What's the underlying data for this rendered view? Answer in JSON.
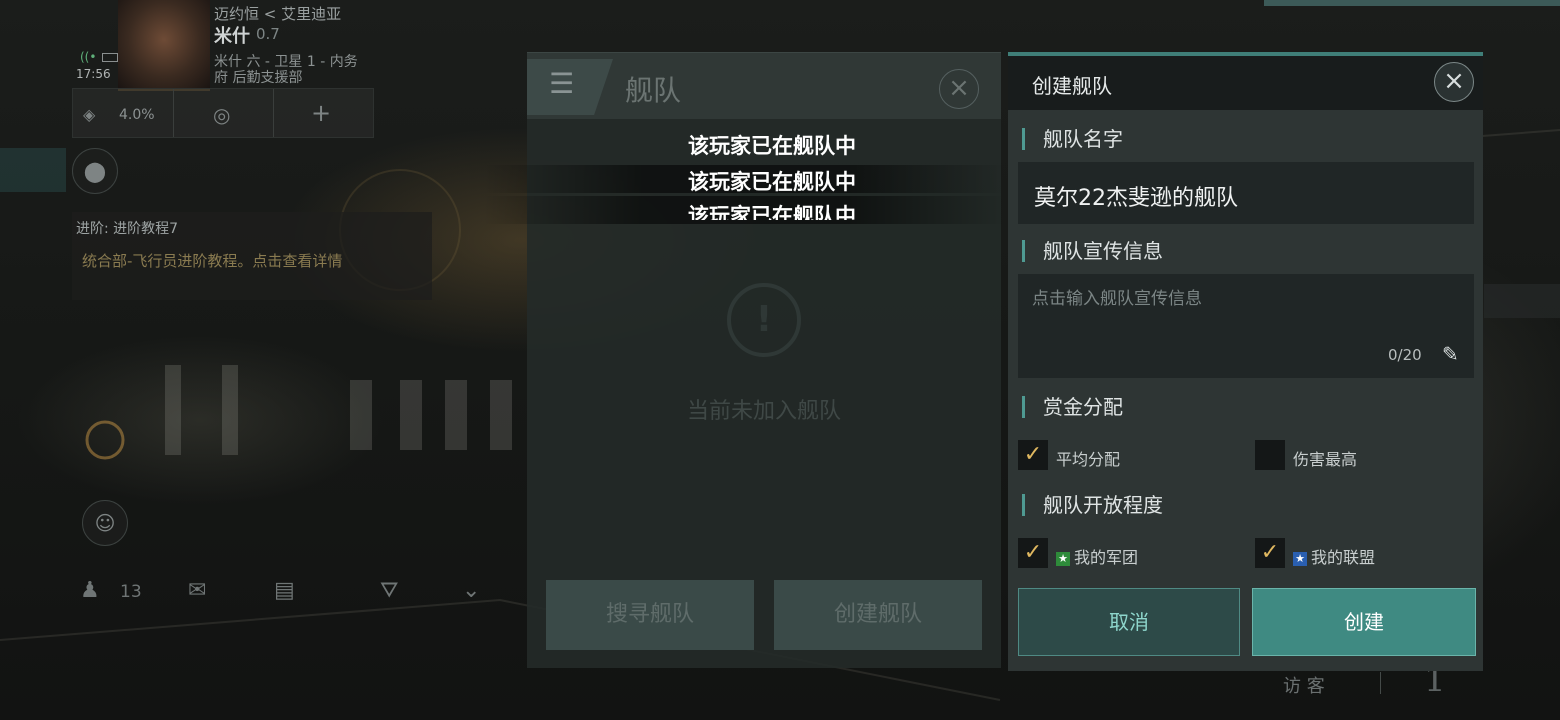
{
  "hud": {
    "location_title": "迈约恒  < 艾里迪亚",
    "system_name": "米什",
    "security": "0.7",
    "station_line1": "米什 六 - 卫星 1 - 内务",
    "station_line2": "府 后勤支援部",
    "time": "17:56",
    "cargo_percent": "4.0%",
    "mission_title": "进阶: 进阶教程7",
    "mission_desc": "统合部-飞行员进阶教程。点击查看详情",
    "local_count": "13",
    "visitor_label": "访 客",
    "visitor_count": "1"
  },
  "fleet_panel": {
    "title": "舰队",
    "empty_text": "当前未加入舰队",
    "search_button": "搜寻舰队",
    "create_button": "创建舰队"
  },
  "toasts": [
    "该玩家已在舰队中",
    "该玩家已在舰队中",
    "该玩家已在舰队中"
  ],
  "create_fleet": {
    "title": "创建舰队",
    "name_label": "舰队名字",
    "name_value": "莫尔22杰斐逊的舰队",
    "promo_label": "舰队宣传信息",
    "promo_placeholder": "点击输入舰队宣传信息",
    "promo_counter": "0/20",
    "bounty_label": "赏金分配",
    "bounty_options": [
      {
        "label": "平均分配",
        "checked": true
      },
      {
        "label": "伤害最高",
        "checked": false
      }
    ],
    "open_label": "舰队开放程度",
    "open_options": [
      {
        "label": "我的军团",
        "checked": true,
        "badge_color": "#2e8b3a"
      },
      {
        "label": "我的联盟",
        "checked": true,
        "badge_color": "#2a5fb0"
      }
    ],
    "cancel_button": "取消",
    "create_button": "创建"
  },
  "colors": {
    "accent": "#3f8a82",
    "check_mark": "#e0b860"
  },
  "icons": {
    "close": "close-icon",
    "edit": "edit-icon",
    "menu": "menu-icon",
    "checkmark": "checkmark-icon"
  }
}
